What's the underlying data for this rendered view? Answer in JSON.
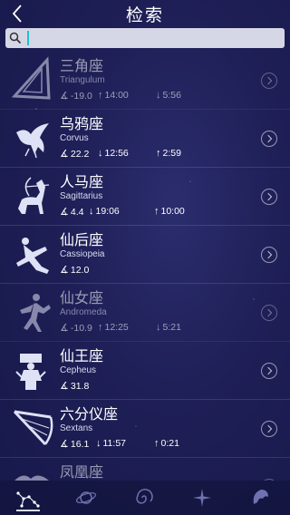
{
  "header": {
    "title": "检索",
    "back_icon": "chevron-left-icon"
  },
  "search": {
    "value": "",
    "placeholder": "",
    "icon": "search-icon"
  },
  "rows": [
    {
      "name": "三角座",
      "latin": "Triangulum",
      "altitude": "-19.0",
      "rise": "14:00",
      "set": "5:56",
      "first_arrow": "↑",
      "second_arrow": "↓",
      "dim": true
    },
    {
      "name": "乌鸦座",
      "latin": "Corvus",
      "altitude": "22.2",
      "rise": "12:56",
      "set": "2:59",
      "first_arrow": "↓",
      "second_arrow": "↑",
      "dim": false
    },
    {
      "name": "人马座",
      "latin": "Sagittarius",
      "altitude": "4.4",
      "rise": "19:06",
      "set": "10:00",
      "first_arrow": "↓",
      "second_arrow": "↑",
      "dim": false
    },
    {
      "name": "仙后座",
      "latin": "Cassiopeia",
      "altitude": "12.0",
      "dim": false
    },
    {
      "name": "仙女座",
      "latin": "Andromeda",
      "altitude": "-10.9",
      "rise": "12:25",
      "set": "5:21",
      "first_arrow": "↑",
      "second_arrow": "↓",
      "dim": true
    },
    {
      "name": "仙王座",
      "latin": "Cepheus",
      "altitude": "31.8",
      "dim": false
    },
    {
      "name": "六分仪座",
      "latin": "Sextans",
      "altitude": "16.1",
      "rise": "11:57",
      "set": "0:21",
      "first_arrow": "↓",
      "second_arrow": "↑",
      "dim": false
    },
    {
      "name": "凤凰座",
      "latin": "",
      "dim": true
    }
  ],
  "tabbar": {
    "tabs": [
      {
        "icon": "constellation-icon",
        "active": true
      },
      {
        "icon": "planet-icon",
        "active": false
      },
      {
        "icon": "galaxy-icon",
        "active": false
      },
      {
        "icon": "star-icon",
        "active": false
      },
      {
        "icon": "satellite-icon",
        "active": false
      }
    ]
  },
  "colors": {
    "background": "#1e1f56",
    "search_bg": "#d6d7e6",
    "caret": "#20c0c8"
  }
}
